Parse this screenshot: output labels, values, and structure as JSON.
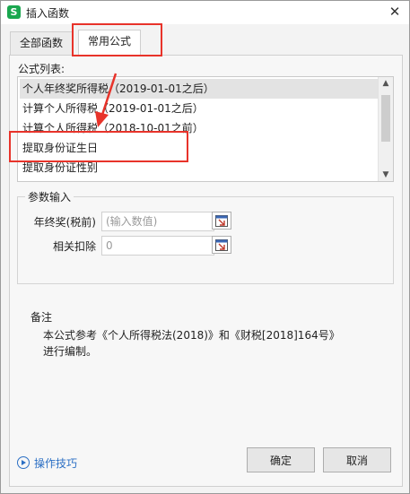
{
  "titlebar": {
    "title": "插入函数",
    "app_icon": "wps-spreadsheet-icon",
    "close_glyph": "✕"
  },
  "tabs": [
    {
      "label": "全部函数",
      "active": false
    },
    {
      "label": "常用公式",
      "active": true
    }
  ],
  "formula_list": {
    "label": "公式列表:",
    "items": [
      "个人年终奖所得税（2019-01-01之后）",
      "计算个人所得税（2019-01-01之后）",
      "计算个人所得税（2018-10-01之前）",
      "提取身份证生日",
      "提取身份证性别"
    ],
    "selected_index": 0
  },
  "params": {
    "legend": "参数输入",
    "fields": [
      {
        "label": "年终奖(税前)",
        "value": "",
        "placeholder": "(输入数值)"
      },
      {
        "label": "相关扣除",
        "value": "0",
        "placeholder": ""
      }
    ]
  },
  "notes": {
    "title": "备注",
    "line1": "本公式参考《个人所得税法(2018)》和《财税[2018]164号》",
    "line2": "进行编制。"
  },
  "footer": {
    "tips_label": "操作技巧",
    "ok_label": "确定",
    "cancel_label": "取消"
  },
  "colors": {
    "annotation": "#e8332a",
    "link": "#2b6fc4",
    "app_icon": "#1aa74f"
  }
}
